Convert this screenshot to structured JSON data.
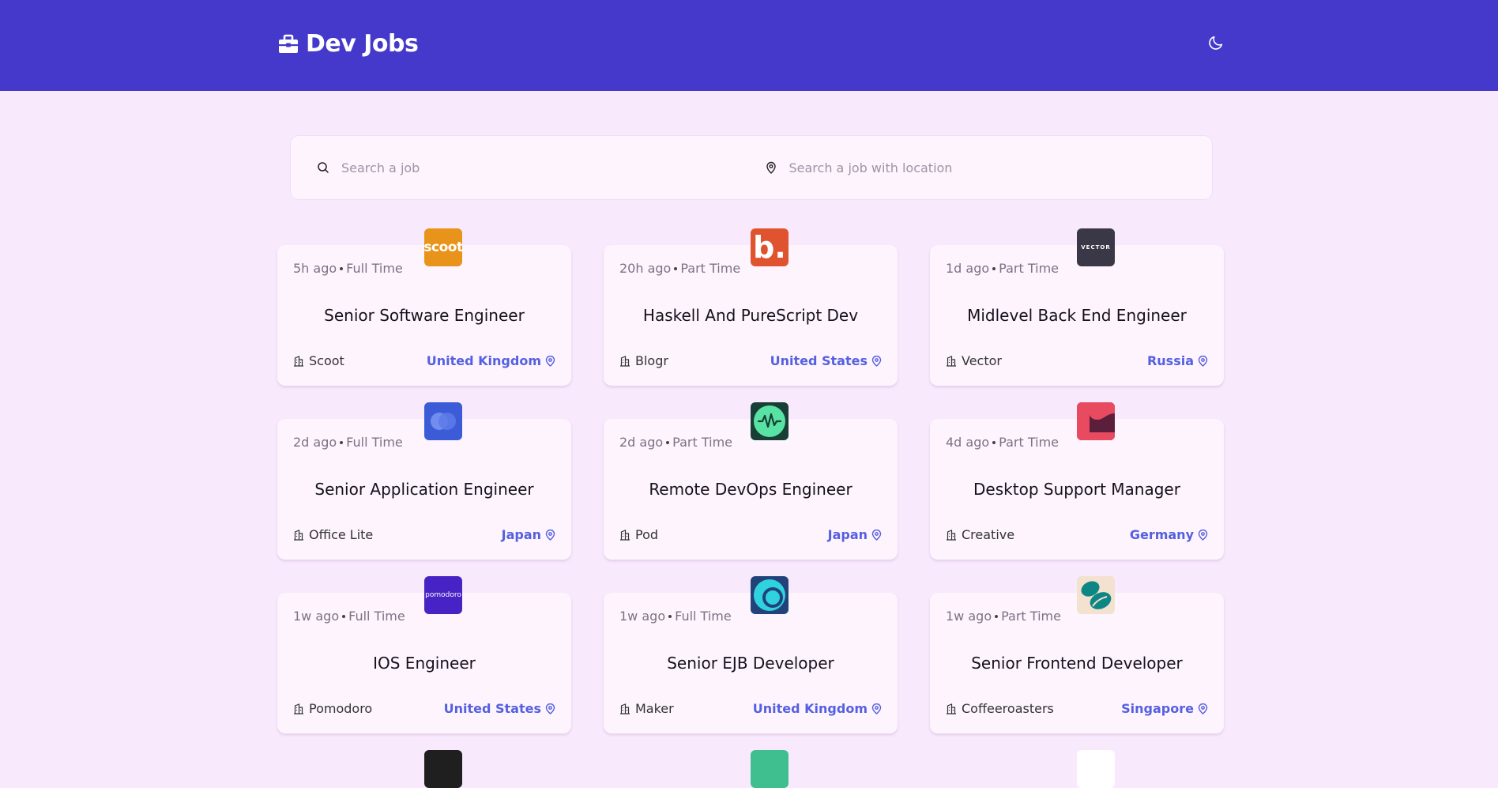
{
  "header": {
    "title": "Dev Jobs",
    "brand_icon": "briefcase-icon",
    "theme_icon": "moon-icon"
  },
  "search": {
    "job_placeholder": "Search a job",
    "location_placeholder": "Search a job with location"
  },
  "colors": {
    "header": "#4539cc",
    "background": "#f9e9fd",
    "card": "#fdf4fe",
    "location": "#5560e0"
  },
  "jobs": [
    {
      "posted": "5h ago",
      "type": "Full Time",
      "title": "Senior Software Engineer",
      "company": "Scoot",
      "location": "United Kingdom",
      "logo_text": "scoot",
      "logo_color": "#e8931a"
    },
    {
      "posted": "20h ago",
      "type": "Part Time",
      "title": "Haskell And PureScript Dev",
      "company": "Blogr",
      "location": "United States",
      "logo_text": "b.",
      "logo_color": "#e0532f"
    },
    {
      "posted": "1d ago",
      "type": "Part Time",
      "title": "Midlevel Back End Engineer",
      "company": "Vector",
      "location": "Russia",
      "logo_text": "VECTOR",
      "logo_color": "#3a3847"
    },
    {
      "posted": "2d ago",
      "type": "Full Time",
      "title": "Senior Application Engineer",
      "company": "Office Lite",
      "location": "Japan",
      "logo_text": "",
      "logo_color": "#3c5bd6"
    },
    {
      "posted": "2d ago",
      "type": "Part Time",
      "title": "Remote DevOps Engineer",
      "company": "Pod",
      "location": "Japan",
      "logo_text": "",
      "logo_color": "#173f35"
    },
    {
      "posted": "4d ago",
      "type": "Part Time",
      "title": "Desktop Support Manager",
      "company": "Creative",
      "location": "Germany",
      "logo_text": "",
      "logo_color": "#5c1f3b"
    },
    {
      "posted": "1w ago",
      "type": "Full Time",
      "title": "IOS Engineer",
      "company": "Pomodoro",
      "location": "United States",
      "logo_text": "pomodoro",
      "logo_color": "#4722c4"
    },
    {
      "posted": "1w ago",
      "type": "Full Time",
      "title": "Senior EJB Developer",
      "company": "Maker",
      "location": "United Kingdom",
      "logo_text": "",
      "logo_color": "#21437a"
    },
    {
      "posted": "1w ago",
      "type": "Part Time",
      "title": "Senior Frontend Developer",
      "company": "Coffeeroasters",
      "location": "Singapore",
      "logo_text": "",
      "logo_color": "#f3e2cf"
    }
  ]
}
